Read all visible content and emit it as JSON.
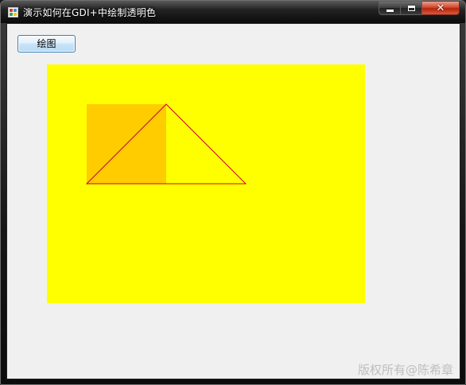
{
  "window": {
    "title": "演示如何在GDI+中绘制透明色",
    "caption_buttons": {
      "minimize_icon": "minimize-icon",
      "maximize_icon": "maximize-icon",
      "close_glyph": "✕"
    }
  },
  "toolbar": {
    "draw_label": "绘图"
  },
  "canvas": {
    "background_color": "#ffff00",
    "rectangle_fill": "#ffcc00",
    "triangle_stroke": "#cc0033"
  },
  "watermark": {
    "text": "版权所有@陈希章"
  }
}
